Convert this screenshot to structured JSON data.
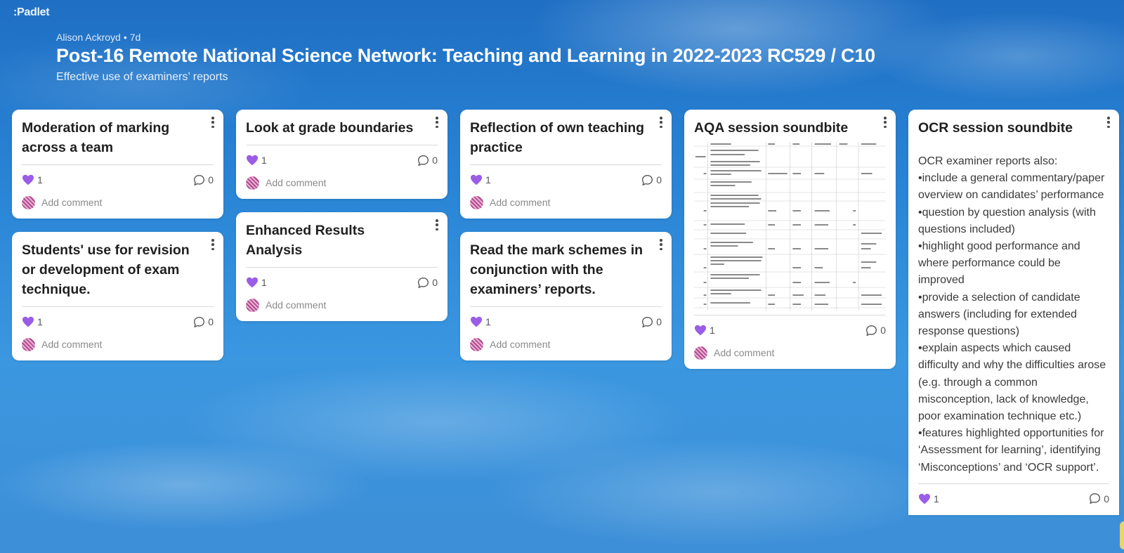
{
  "app": {
    "logo": ":Padlet"
  },
  "header": {
    "author": "Alison Ackroyd",
    "separator": "•",
    "age": "7d",
    "title": "Post-16 Remote National Science Network: Teaching and Learning in 2022-2023 RC529 / C10",
    "subtitle": "Effective use of examiners’ reports"
  },
  "add_comment_label": "Add comment",
  "columns": [
    {
      "cards": [
        {
          "title": "Moderation of marking across a team",
          "likes": "1",
          "comments": "0"
        },
        {
          "title": "Students' use for revision or development of exam technique.",
          "likes": "1",
          "comments": "0"
        }
      ]
    },
    {
      "cards": [
        {
          "title": "Look at grade boundaries",
          "likes": "1",
          "comments": "0"
        },
        {
          "title": "Enhanced Results Analysis",
          "likes": "1",
          "comments": "0"
        }
      ]
    },
    {
      "cards": [
        {
          "title": "Reflection of own teaching practice",
          "likes": "1",
          "comments": "0"
        },
        {
          "title": "Read the mark schemes in conjunction with the examiners’ reports.",
          "likes": "1",
          "comments": "0"
        }
      ]
    },
    {
      "cards": [
        {
          "title": "AQA session soundbite",
          "likes": "1",
          "comments": "0",
          "attachment": "spreadsheet-thumbnail"
        }
      ]
    },
    {
      "cards": [
        {
          "title": "OCR session soundbite",
          "likes": "1",
          "comments": "0",
          "body": [
            "OCR examiner reports also:",
            "•include a general commentary/paper overview on candidates’ performance",
            "•question by question analysis (with questions included)",
            "•highlight good performance and where performance could be improved",
            "•provide a selection of candidate answers (including for extended response questions)",
            "•explain aspects which caused difficulty and why the difficulties arose (e.g. through a common misconception, lack of knowledge, poor examination technique etc.)",
            "•features highlighted opportunities for ‘Assessment for learning’, identifying ‘Misconceptions’ and ‘OCR support’."
          ]
        }
      ]
    }
  ],
  "colors": {
    "heart": "#9b5de5",
    "avatar": "#b44a8f",
    "background": "#2a85d6"
  },
  "icons": [
    "heart-icon",
    "comment-icon",
    "more-icon",
    "avatar"
  ]
}
